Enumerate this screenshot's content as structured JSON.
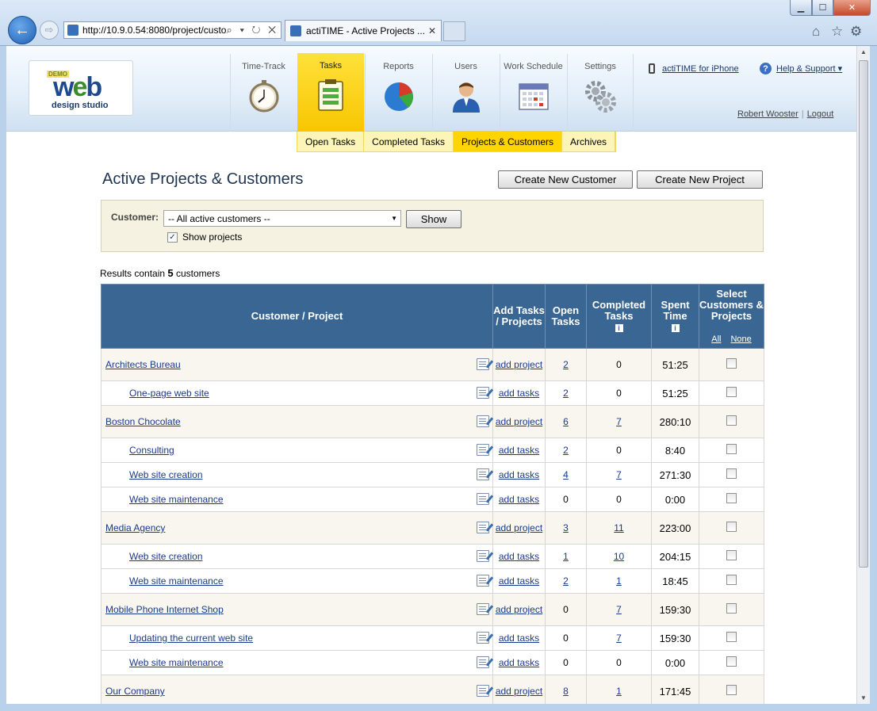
{
  "browser": {
    "address": "http://10.9.0.54:8080/project/custo",
    "tab_title": "actiTIME - Active Projects ...",
    "address_tools": "⌕ ▾ ↻ ✕",
    "tab_close": "✕",
    "back_glyph": "←",
    "forward_glyph": "⇨",
    "minimize": "▁",
    "maximize": "☐",
    "close": "✕",
    "home_glyph": "⌂",
    "favorites_glyph": "☆",
    "tools_glyph": "⚙"
  },
  "app": {
    "logo": {
      "demo": "DEMO",
      "web": "web",
      "subtitle": "design studio"
    },
    "modules": [
      {
        "label": "Time-Track",
        "icon": "stopwatch-icon"
      },
      {
        "label": "Tasks",
        "icon": "clipboard-icon"
      },
      {
        "label": "Reports",
        "icon": "pie-chart-icon"
      },
      {
        "label": "Users",
        "icon": "user-icon"
      },
      {
        "label": "Work Schedule",
        "icon": "calendar-icon"
      },
      {
        "label": "Settings",
        "icon": "gears-icon"
      }
    ],
    "subnav": [
      "Open Tasks",
      "Completed Tasks",
      "Projects & Customers",
      "Archives"
    ],
    "iphone_link": "actiTIME for iPhone",
    "help_link": "Help & Support ▾",
    "help_glyph": "?",
    "user_name": "Robert Wooster",
    "user_sep": "|",
    "logout": "Logout"
  },
  "page": {
    "title": "Active Projects & Customers",
    "create_customer": "Create New Customer",
    "create_project": "Create New Project",
    "filter": {
      "label": "Customer:",
      "selected": "-- All active customers --",
      "show_button": "Show",
      "show_projects_label": "Show projects",
      "show_projects_checked": "✓"
    },
    "results_prefix": "Results contain",
    "results_count": "5",
    "results_suffix": "customers"
  },
  "table": {
    "headers": {
      "name": "Customer / Project",
      "add": "Add Tasks / Projects",
      "open": "Open Tasks",
      "completed": "Completed Tasks",
      "spent": "Spent Time",
      "select": "Select Customers & Projects",
      "select_all": "All",
      "select_none": "None",
      "info_glyph": "i"
    },
    "rows": [
      {
        "kind": "cust",
        "name": "Architects Bureau",
        "add": "add project",
        "open": "2",
        "open_link": true,
        "completed": "0",
        "completed_link": false,
        "spent": "51:25"
      },
      {
        "kind": "proj",
        "name": "One-page web site",
        "add": "add tasks",
        "open": "2",
        "open_link": true,
        "completed": "0",
        "completed_link": false,
        "spent": "51:25"
      },
      {
        "kind": "cust",
        "name": "Boston Chocolate",
        "add": "add project",
        "open": "6",
        "open_link": true,
        "completed": "7",
        "completed_link": true,
        "spent": "280:10"
      },
      {
        "kind": "proj",
        "name": "Consulting",
        "add": "add tasks",
        "open": "2",
        "open_link": true,
        "completed": "0",
        "completed_link": false,
        "spent": "8:40"
      },
      {
        "kind": "proj",
        "name": "Web site creation",
        "add": "add tasks",
        "open": "4",
        "open_link": true,
        "completed": "7",
        "completed_link": true,
        "spent": "271:30"
      },
      {
        "kind": "proj",
        "name": "Web site maintenance",
        "add": "add tasks",
        "open": "0",
        "open_link": false,
        "completed": "0",
        "completed_link": false,
        "spent": "0:00"
      },
      {
        "kind": "cust",
        "name": "Media Agency",
        "add": "add project",
        "open": "3",
        "open_link": true,
        "completed": "11",
        "completed_link": true,
        "spent": "223:00"
      },
      {
        "kind": "proj",
        "name": "Web site creation",
        "add": "add tasks",
        "open": "1",
        "open_link": true,
        "completed": "10",
        "completed_link": true,
        "spent": "204:15"
      },
      {
        "kind": "proj",
        "name": "Web site maintenance",
        "add": "add tasks",
        "open": "2",
        "open_link": true,
        "completed": "1",
        "completed_link": true,
        "spent": "18:45"
      },
      {
        "kind": "cust",
        "name": "Mobile Phone Internet Shop",
        "add": "add project",
        "open": "0",
        "open_link": false,
        "completed": "7",
        "completed_link": true,
        "spent": "159:30"
      },
      {
        "kind": "proj",
        "name": "Updating the current web site",
        "add": "add tasks",
        "open": "0",
        "open_link": false,
        "completed": "7",
        "completed_link": true,
        "spent": "159:30"
      },
      {
        "kind": "proj",
        "name": "Web site maintenance",
        "add": "add tasks",
        "open": "0",
        "open_link": false,
        "completed": "0",
        "completed_link": false,
        "spent": "0:00"
      },
      {
        "kind": "cust",
        "name": "Our Company",
        "add": "add project",
        "open": "8",
        "open_link": true,
        "completed": "1",
        "completed_link": true,
        "spent": "171:45"
      }
    ]
  },
  "colors": {
    "header_blue": "#396693",
    "tab_yellow": "#ffd400",
    "link_blue": "#1a3a8c"
  }
}
